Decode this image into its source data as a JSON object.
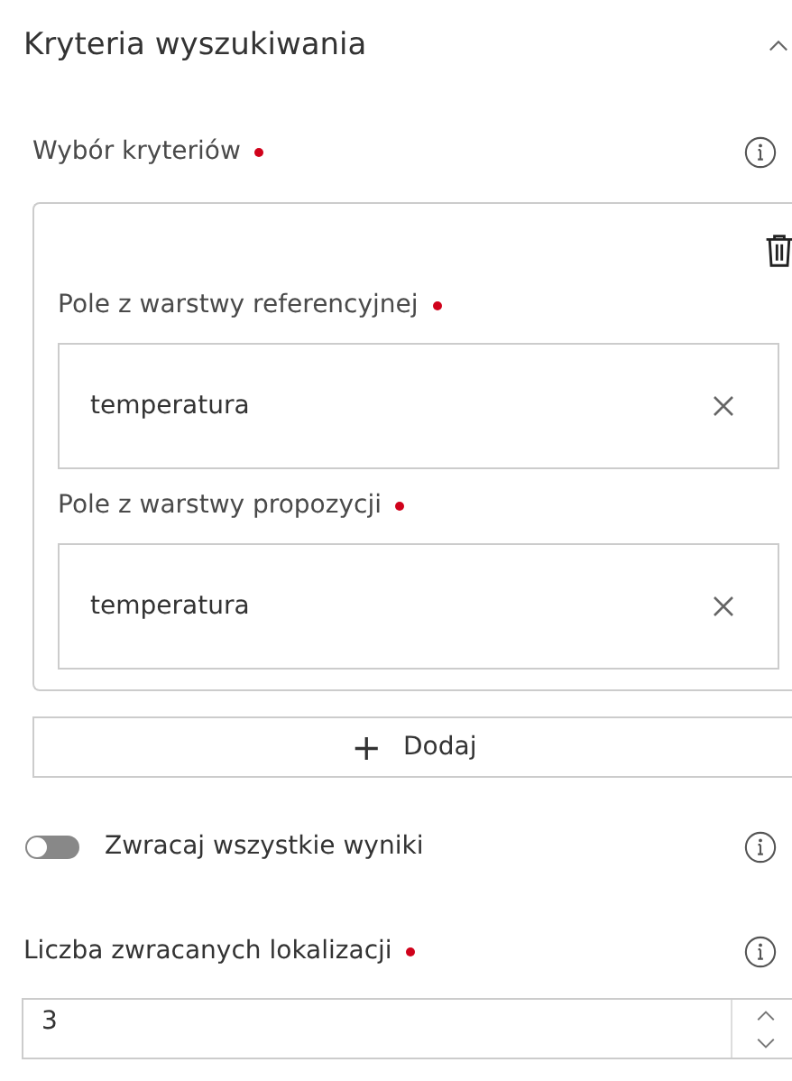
{
  "section": {
    "title": "Kryteria wyszukiwania",
    "expanded": true
  },
  "criteria": {
    "label": "Wybór kryteriów",
    "required": true,
    "fields": [
      {
        "label": "Pole z warstwy referencyjnej",
        "required": true,
        "value": "temperatura"
      },
      {
        "label": "Pole z warstwy propozycji",
        "required": true,
        "value": "temperatura"
      }
    ]
  },
  "add_button": {
    "icon": "+",
    "label": "Dodaj"
  },
  "toggle": {
    "label": "Zwracaj wszystkie wyniki",
    "on": false
  },
  "count": {
    "label": "Liczba zwracanych lokalizacji",
    "required": true,
    "value": "3"
  }
}
